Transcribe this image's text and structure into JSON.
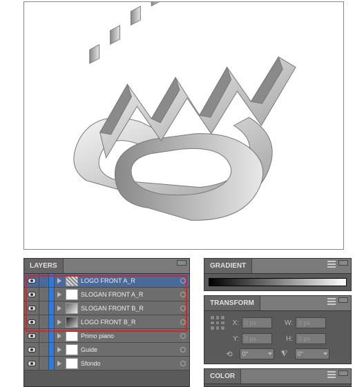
{
  "canvas": {
    "desc": "3D extruded logo artwork"
  },
  "layers_panel": {
    "title": "LAYERS",
    "items": [
      {
        "name": "LOGO FRONT A_R",
        "thumb": "pat",
        "highlighted": true,
        "selected": true
      },
      {
        "name": "SLOGAN FRONT A_R",
        "thumb": "blank",
        "highlighted": true,
        "selected": false
      },
      {
        "name": "SLOGAN FRONT B_R",
        "thumb": "grad",
        "highlighted": true,
        "selected": false
      },
      {
        "name": "LOGO FRONT B_R",
        "thumb": "grad2",
        "highlighted": true,
        "selected": false
      },
      {
        "name": "Primo piano",
        "thumb": "blank",
        "highlighted": false,
        "selected": false
      },
      {
        "name": "Guide",
        "thumb": "blank",
        "highlighted": false,
        "selected": false
      },
      {
        "name": "Sfondo",
        "thumb": "blank",
        "highlighted": false,
        "selected": false
      }
    ]
  },
  "gradient_panel": {
    "title": "GRADIENT"
  },
  "transform_panel": {
    "title": "TRANSFORM",
    "x_label": "X:",
    "x_value": "0 px",
    "y_label": "Y:",
    "y_value": "0 px",
    "w_label": "W:",
    "w_value": "0 px",
    "h_label": "H:",
    "h_value": "0 px",
    "rotate_value": "0°",
    "shear_value": "0°"
  },
  "color_panel": {
    "title": "COLOR"
  }
}
